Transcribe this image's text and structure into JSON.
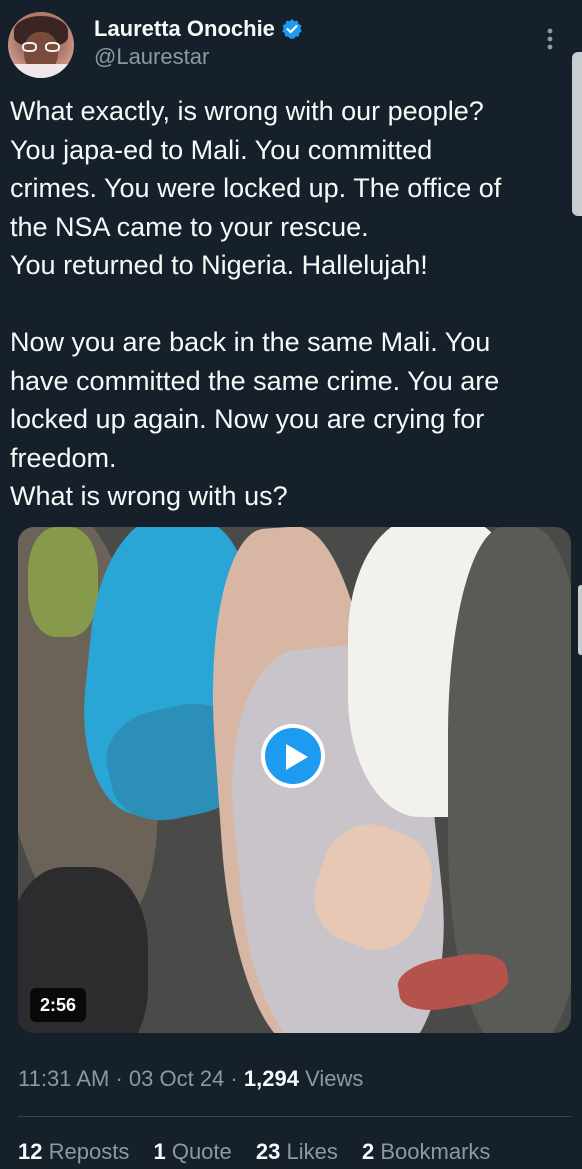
{
  "author": {
    "display_name": "Lauretta Onochie",
    "handle": "@Laurestar",
    "verified_icon": "verified-badge-icon"
  },
  "tweet": {
    "text": "What exactly, is wrong with our people?\nYou japa-ed to Mali. You committed\ncrimes. You were locked up. The office of\nthe NSA came to your rescue.\nYou returned to Nigeria. Hallelujah!\n\nNow you are back in the same Mali. You\nhave committed the same crime. You are\nlocked up again. Now you are crying for\nfreedom.\nWhat is wrong with us?"
  },
  "media": {
    "type": "video",
    "duration": "2:56",
    "play_icon": "play-icon"
  },
  "meta": {
    "time": "11:31 AM",
    "separator": "·",
    "date": "03 Oct 24",
    "views_count": "1,294",
    "views_label": "Views"
  },
  "stats": {
    "reposts_count": "12",
    "reposts_label": "Reposts",
    "quotes_count": "1",
    "quotes_label": "Quote",
    "likes_count": "23",
    "likes_label": "Likes",
    "bookmarks_count": "2",
    "bookmarks_label": "Bookmarks"
  },
  "colors": {
    "background": "#15202b",
    "text_primary": "#f7f9f9",
    "text_secondary": "#8b98a5",
    "accent": "#1d9bf0",
    "divider": "#38444d"
  }
}
